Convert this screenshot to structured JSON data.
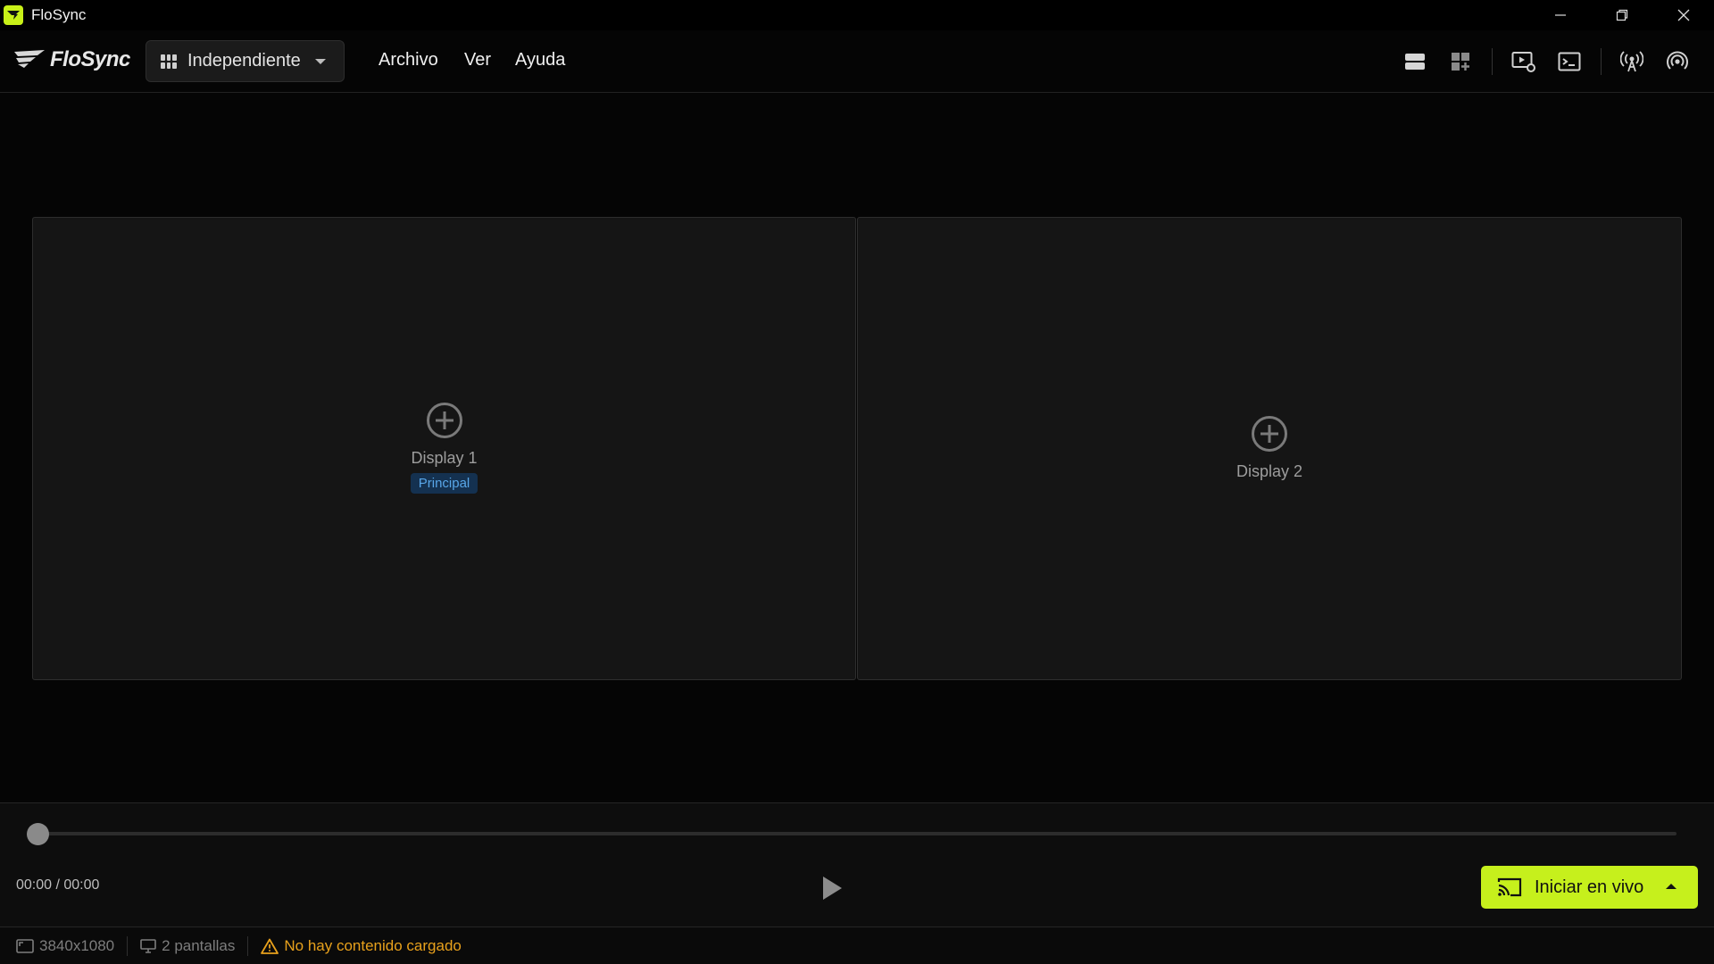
{
  "window": {
    "title": "FloSync"
  },
  "menubar": {
    "logo_text": "FloSync",
    "mode_select": {
      "value": "Independiente"
    },
    "menu": [
      "Archivo",
      "Ver",
      "Ayuda"
    ],
    "tools": [
      "single-layout-icon",
      "add-grid-icon",
      "media-settings-icon",
      "terminal-icon",
      "broadcast-antenna-icon",
      "signal-icon"
    ]
  },
  "displays": [
    {
      "label": "Display 1",
      "badge": "Principal"
    },
    {
      "label": "Display 2",
      "badge": ""
    }
  ],
  "player": {
    "time": "00:00 / 00:00",
    "progress": 0,
    "live_button": "Iniciar en vivo"
  },
  "statusbar": {
    "resolution": "3840x1080",
    "screens": "2 pantallas",
    "warning": "No hay contenido cargado"
  },
  "colors": {
    "accent": "#c6f01c",
    "badge_text": "#58a6e8",
    "warning": "#e8a11c"
  }
}
